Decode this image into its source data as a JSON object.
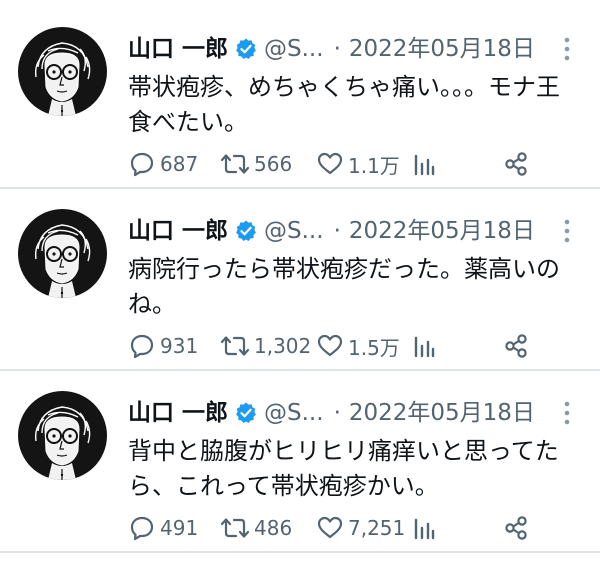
{
  "tweets": [
    {
      "name": "山口 一郎",
      "handle": "@S...",
      "separator": "·",
      "date": "2022年05月18日",
      "text": "帯状疱疹、めちゃくちゃ痛い。。。モナ王食べたい。",
      "replies": "687",
      "retweets": "566",
      "likes": "1.1万"
    },
    {
      "name": "山口 一郎",
      "handle": "@S...",
      "separator": "·",
      "date": "2022年05月18日",
      "text": "病院行ったら帯状疱疹だった。薬高いのね。",
      "replies": "931",
      "retweets": "1,302",
      "likes": "1.5万"
    },
    {
      "name": "山口 一郎",
      "handle": "@S...",
      "separator": "·",
      "date": "2022年05月18日",
      "text": "背中と脇腹がヒリヒリ痛痒いと思ってたら、これって帯状疱疹かい。",
      "replies": "491",
      "retweets": "486",
      "likes": "7,251"
    }
  ],
  "colors": {
    "text_primary": "#0f1419",
    "text_secondary": "#536471",
    "verified_badge": "#1d9bf0",
    "divider": "#dfe3e6"
  },
  "icons": {
    "verified": "verified-badge-icon",
    "more": "more-options-icon",
    "reply": "reply-icon",
    "retweet": "retweet-icon",
    "like": "heart-icon",
    "views": "analytics-icon",
    "share": "share-icon"
  }
}
